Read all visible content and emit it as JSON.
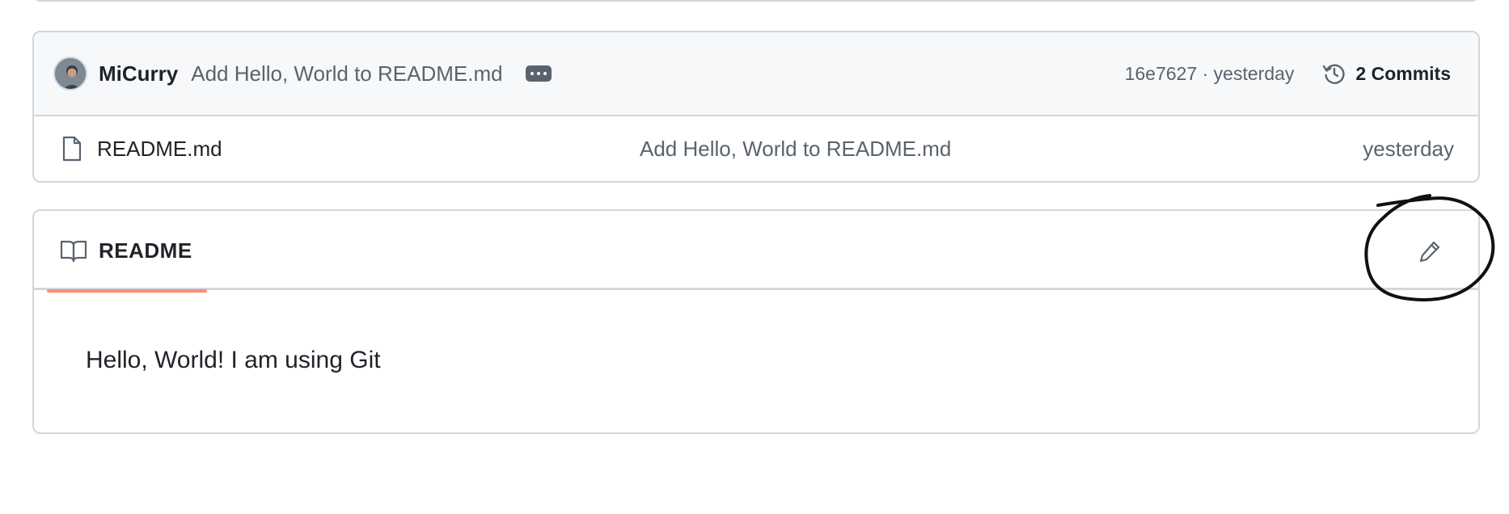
{
  "latest_commit": {
    "author": "MiCurry",
    "message": "Add Hello, World to README.md",
    "meta": "16e7627 · yesterday",
    "commits_label": "2 Commits"
  },
  "files": [
    {
      "name": "README.md",
      "commit_message": "Add Hello, World to README.md",
      "date": "yesterday"
    }
  ],
  "readme": {
    "tab_label": "README",
    "content": "Hello, World! I am using Git"
  },
  "colors": {
    "accent_underline": "#fd8c73",
    "border": "#d0d7de",
    "muted_text": "#59636e",
    "header_bg": "#f6f8fa"
  },
  "icons": {
    "avatar": "user-avatar",
    "ellipsis": "kebab-horizontal-icon",
    "history": "history-icon",
    "file": "file-icon",
    "book": "book-icon",
    "edit": "pencil-icon",
    "annotation": "hand-drawn-circle"
  }
}
